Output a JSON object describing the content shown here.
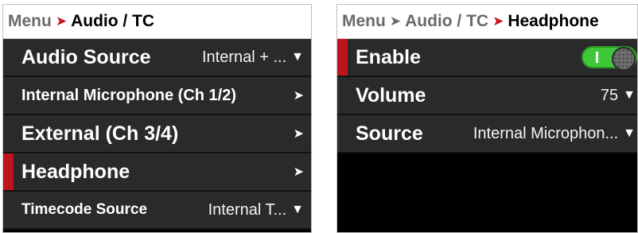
{
  "left_panel": {
    "breadcrumb": {
      "root": "Menu",
      "current": "Audio / TC"
    },
    "items": [
      {
        "label": "Audio Source",
        "value": "Internal + ...",
        "control": "dropdown"
      },
      {
        "label": "Internal Microphone (Ch 1/2)",
        "value": "",
        "control": "submenu"
      },
      {
        "label": "External (Ch 3/4)",
        "value": "",
        "control": "submenu"
      },
      {
        "label": "Headphone",
        "value": "",
        "control": "submenu",
        "selected": true
      },
      {
        "label": "Timecode Source",
        "value": "Internal T...",
        "control": "dropdown"
      }
    ]
  },
  "right_panel": {
    "breadcrumb": {
      "root": "Menu",
      "middle": "Audio / TC",
      "current": "Headphone"
    },
    "items": [
      {
        "label": "Enable",
        "control": "toggle",
        "state": "on",
        "selected": true
      },
      {
        "label": "Volume",
        "value": "75",
        "control": "dropdown"
      },
      {
        "label": "Source",
        "value": "Internal Microphon...",
        "control": "dropdown"
      }
    ]
  },
  "icons": {
    "breadcrumb_separator": "chevron-right-icon",
    "submenu": "chevron-right-icon",
    "dropdown": "chevron-down-icon"
  },
  "colors": {
    "accent": "#c0141c",
    "row_background": "#2a2a2a",
    "toggle_on": "#3ec83a"
  }
}
